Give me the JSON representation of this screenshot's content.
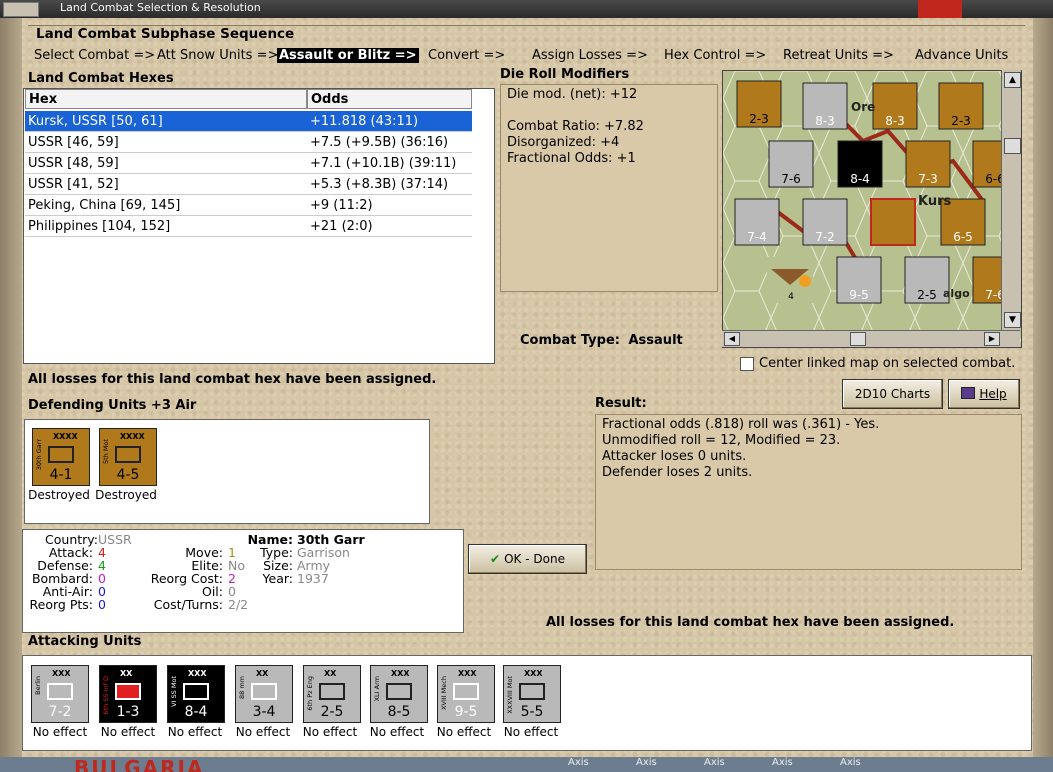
{
  "window": {
    "title": "Land Combat Selection & Resolution"
  },
  "subphase": {
    "header": "Land Combat Subphase Sequence",
    "steps": [
      "Select Combat =>",
      "Att Snow Units =>",
      "Assault or Blitz =>",
      "Convert =>",
      "Assign Losses =>",
      "Hex Control =>",
      "Retreat Units =>",
      "Advance Units"
    ],
    "active_index": 2
  },
  "hexes": {
    "header": "Land Combat Hexes",
    "columns": [
      "Hex",
      "Odds"
    ],
    "rows": [
      {
        "hex": "Kursk, USSR [50, 61]",
        "odds": "+11.818 (43:11)"
      },
      {
        "hex": "USSR [46, 59]",
        "odds": "+7.5 (+9.5B) (36:16)"
      },
      {
        "hex": "USSR [48, 59]",
        "odds": "+7.1 (+10.1B) (39:11)"
      },
      {
        "hex": "USSR [41, 52]",
        "odds": "+5.3 (+8.3B) (37:14)"
      },
      {
        "hex": "Peking, China [69, 145]",
        "odds": "+9 (11:2)"
      },
      {
        "hex": "Philippines [104, 152]",
        "odds": "+21 (2:0)"
      }
    ],
    "selected_index": 0
  },
  "drm": {
    "header": "Die Roll Modifiers",
    "lines": [
      "Die mod. (net): +12",
      "",
      "Combat Ratio: +7.82",
      "Disorganized: +4",
      "Fractional Odds: +1"
    ]
  },
  "combat_type": {
    "label": "Combat Type:",
    "value": "Assault"
  },
  "center_map": {
    "label": "Center linked map on selected combat.",
    "checked": false
  },
  "losses_assigned_top": "All losses for this land combat hex have been assigned.",
  "losses_assigned_bottom": "All losses for this land combat hex have been assigned.",
  "buttons": {
    "charts": "2D10 Charts",
    "help": "Help",
    "ok": "OK - Done"
  },
  "result": {
    "header": "Result:",
    "lines": [
      "Fractional odds (.818) roll was (.361)  - Yes.",
      "Unmodified roll = 12, Modified = 23.",
      "Attacker loses 0 units.",
      "Defender loses 2 units."
    ]
  },
  "defending": {
    "header": "Defending Units +3 Air",
    "units": [
      {
        "name": "30th Garr",
        "size": "XXXX",
        "strength": "4-1",
        "status": "Destroyed",
        "color": "#b07a1c"
      },
      {
        "name": "5th Mot",
        "size": "XXXX",
        "strength": "4-5",
        "status": "Destroyed",
        "color": "#b07a1c"
      }
    ]
  },
  "info": {
    "country_label": "Country:",
    "country": "USSR",
    "attack_label": "Attack:",
    "attack": "4",
    "defense_label": "Defense:",
    "defense": "4",
    "bombard_label": "Bombard:",
    "bombard": "0",
    "antiair_label": "Anti-Air:",
    "antiair": "0",
    "reorgpts_label": "Reorg Pts:",
    "reorgpts": "0",
    "move_label": "Move:",
    "move": "1",
    "elite_label": "Elite:",
    "elite": "No",
    "reorgcost_label": "Reorg Cost:",
    "reorgcost": "2",
    "oil_label": "Oil:",
    "oil": "0",
    "costturns_label": "Cost/Turns:",
    "costturns": "2/2",
    "name_label": "Name:",
    "name": "30th Garr",
    "type_label": "Type:",
    "type": "Garrison",
    "size_label": "Size:",
    "size": "Army",
    "year_label": "Year:",
    "year": "1937"
  },
  "attacking": {
    "header": "Attacking Units",
    "units": [
      {
        "name": "Berlin",
        "size": "XXX",
        "strength": "7-2",
        "status": "No effect",
        "color": "#b9b9b9",
        "text": "#fff"
      },
      {
        "name": "6th SS Inf D",
        "size": "XX",
        "strength": "1-3",
        "status": "No effect",
        "color": "#000",
        "text": "#fff"
      },
      {
        "name": "VI SS Mot",
        "size": "XXX",
        "strength": "8-4",
        "status": "No effect",
        "color": "#000",
        "text": "#fff"
      },
      {
        "name": "88 mm",
        "size": "XX",
        "strength": "3-4",
        "status": "No effect",
        "color": "#b9b9b9",
        "text": "#000"
      },
      {
        "name": "6th Pz Eng",
        "size": "XX",
        "strength": "2-5",
        "status": "No effect",
        "color": "#b9b9b9",
        "text": "#000"
      },
      {
        "name": "XLI Arm",
        "size": "XXX",
        "strength": "8-5",
        "status": "No effect",
        "color": "#b9b9b9",
        "text": "#000"
      },
      {
        "name": "XVIII Mech",
        "size": "XXX",
        "strength": "9-5",
        "status": "No effect",
        "color": "#b9b9b9",
        "text": "#fff"
      },
      {
        "name": "XXXVIII Mot",
        "size": "XXX",
        "strength": "5-5",
        "status": "No effect",
        "color": "#b9b9b9",
        "text": "#000"
      }
    ]
  },
  "map": {
    "labels": [
      "Ore",
      "Kurs",
      "algo"
    ],
    "counters": [
      "2-3",
      "8-3",
      "8-3",
      "7-6",
      "8-4",
      "7-3",
      "6-6",
      "7-4",
      "7-2",
      "6-5",
      "9-5",
      "2-5",
      "7-6",
      "4"
    ]
  },
  "bottom_strip": {
    "left_text": "BULGARIA",
    "axis_labels": [
      "Axis",
      "Axis",
      "Axis",
      "Axis",
      "Axis"
    ]
  }
}
